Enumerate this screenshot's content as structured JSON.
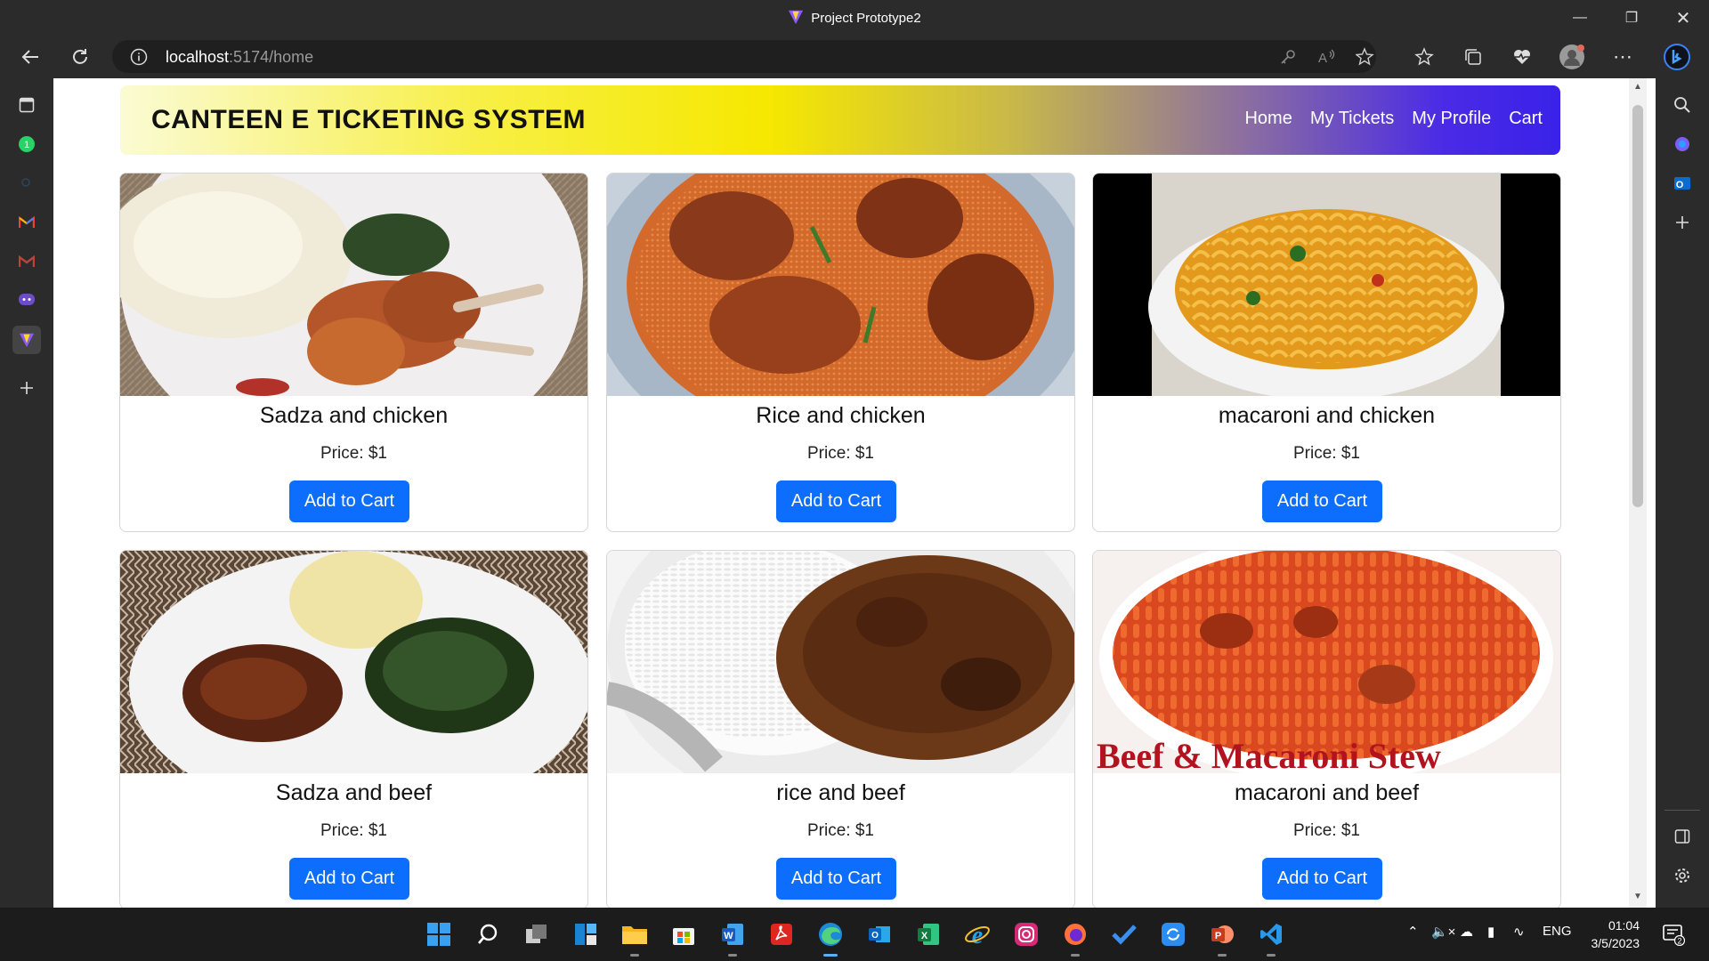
{
  "window": {
    "title": "Project Prototype2"
  },
  "browser": {
    "url_host": "localhost",
    "url_rest": ":5174/home"
  },
  "site": {
    "brand": "CANTEEN E TICKETING SYSTEM",
    "nav": [
      "Home",
      "My Tickets",
      "My Profile",
      "Cart"
    ]
  },
  "products": [
    {
      "name": "Sadza and chicken",
      "price": "Price: $1",
      "button": "Add to Cart"
    },
    {
      "name": "Rice and chicken",
      "price": "Price: $1",
      "button": "Add to Cart"
    },
    {
      "name": "macaroni and chicken",
      "price": "Price: $1",
      "button": "Add to Cart"
    },
    {
      "name": "Sadza and beef",
      "price": "Price: $1",
      "button": "Add to Cart"
    },
    {
      "name": "rice and beef",
      "price": "Price: $1",
      "button": "Add to Cart"
    },
    {
      "name": "macaroni and beef",
      "price": "Price: $1",
      "button": "Add to Cart",
      "image_caption": "Beef & Macaroni Stew"
    }
  ],
  "taskbar": {
    "language": "ENG",
    "time": "01:04",
    "date": "3/5/2023",
    "notification_count": "2"
  },
  "colors": {
    "button_primary": "#0d6efd",
    "browser_chrome": "#2b2b2b",
    "taskbar": "#1c1c1c"
  }
}
